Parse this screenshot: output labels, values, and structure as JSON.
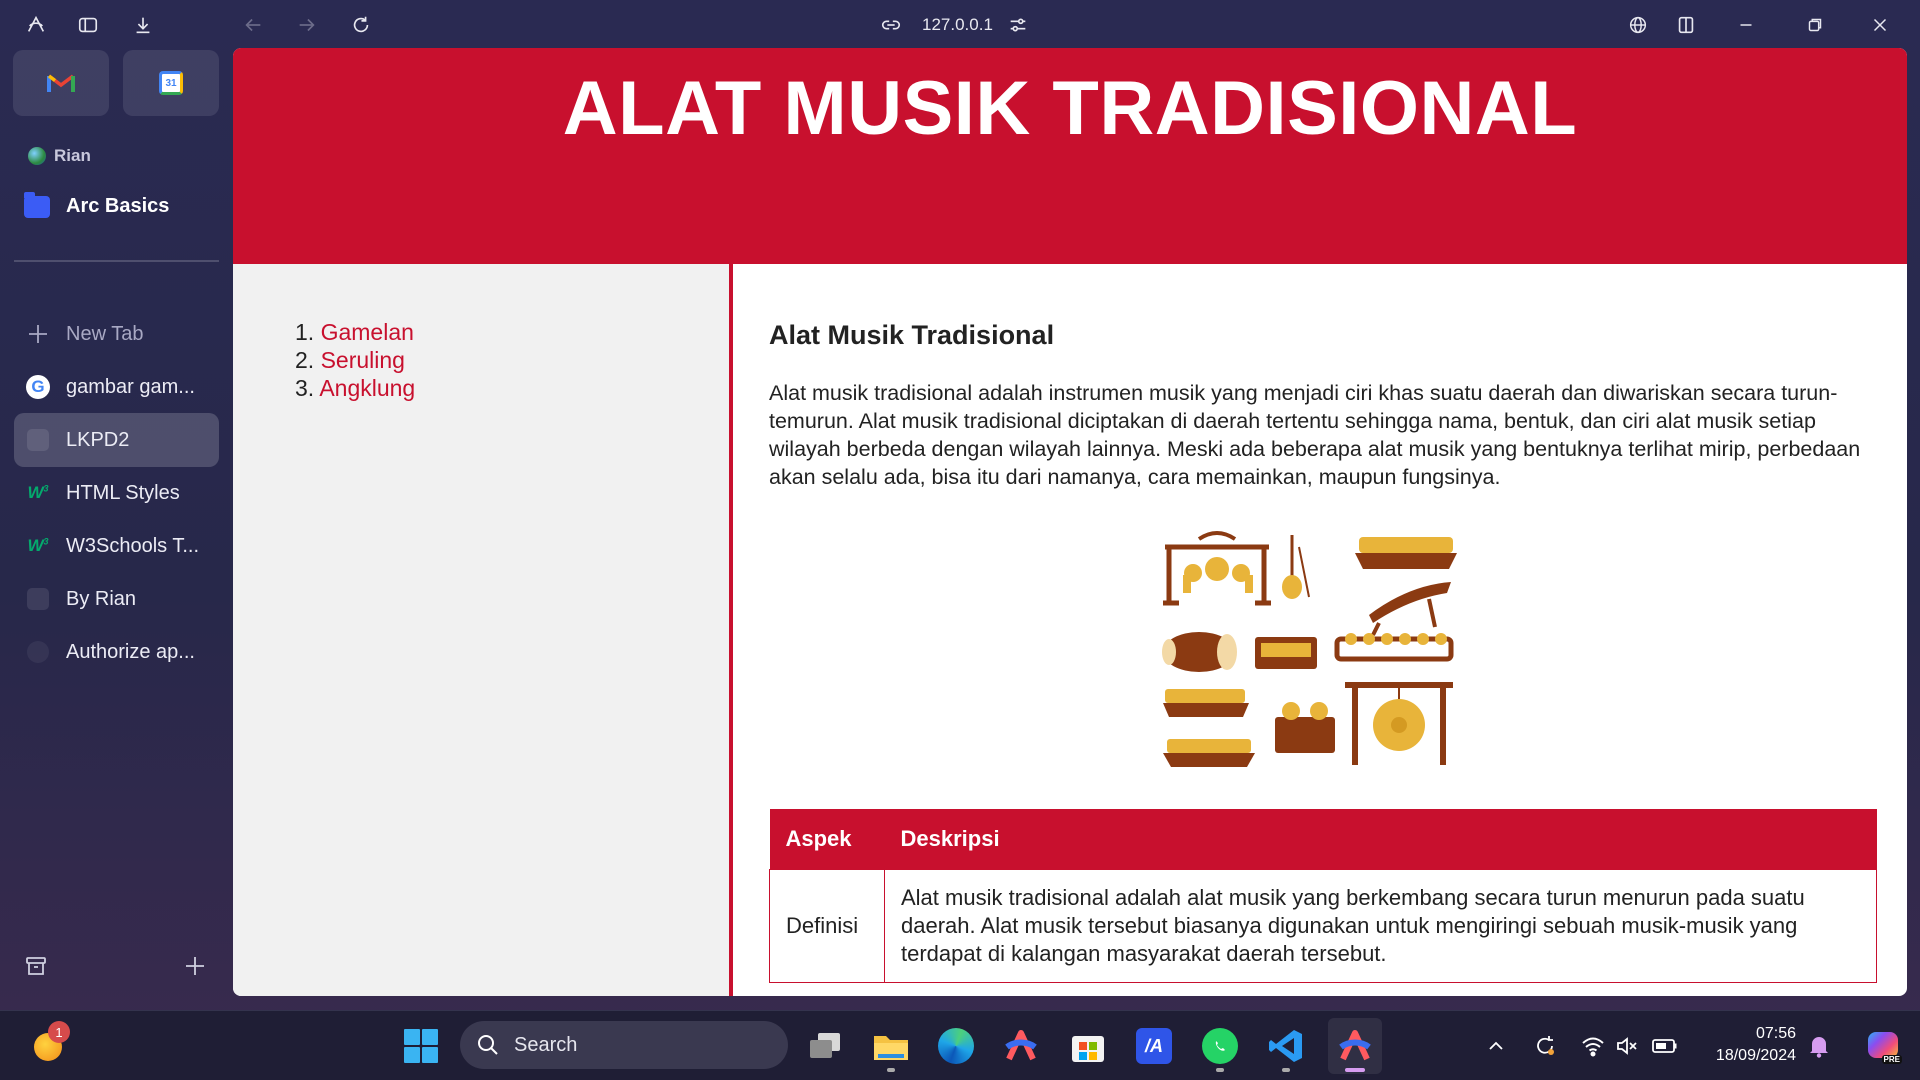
{
  "browser": {
    "url": "127.0.0.1",
    "profile_name": "Rian",
    "space_name": "Arc Basics",
    "new_tab_label": "New Tab",
    "tabs": [
      {
        "label": "gambar gam...",
        "icon": "google-icon"
      },
      {
        "label": "LKPD2",
        "icon": "blank-favicon",
        "active": true
      },
      {
        "label": "HTML Styles",
        "icon": "w3schools-icon"
      },
      {
        "label": "W3Schools T...",
        "icon": "w3schools-icon"
      },
      {
        "label": "By Rian",
        "icon": "blank-favicon"
      },
      {
        "label": "Authorize ap...",
        "icon": "blank-favicon"
      }
    ],
    "pinned": [
      "gmail-icon",
      "google-calendar-icon"
    ],
    "calendar_day": "31"
  },
  "page": {
    "banner_title": "ALAT MUSIK TRADISIONAL",
    "nav": [
      {
        "num": "1.",
        "label": "Gamelan"
      },
      {
        "num": "2.",
        "label": "Seruling"
      },
      {
        "num": "3.",
        "label": "Angklung"
      }
    ],
    "heading": "Alat Musik Tradisional",
    "intro": "Alat musik tradisional adalah instrumen musik yang menjadi ciri khas suatu daerah dan diwariskan secara turun-temurun. Alat musik tradisional diciptakan di daerah tertentu sehingga nama, bentuk, dan ciri alat musik setiap wilayah berbeda dengan wilayah lainnya. Meski ada beberapa alat musik yang bentuknya terlihat mirip, perbedaan akan selalu ada, bisa itu dari namanya, cara memainkan, maupun fungsinya.",
    "table": {
      "headers": [
        "Aspek",
        "Deskripsi"
      ],
      "rows": [
        [
          "Definisi",
          "Alat musik tradisional adalah alat musik yang berkembang secara turun menurun pada suatu daerah. Alat musik tersebut biasanya digunakan untuk mengiringi sebuah musik-musik yang terdapat di kalangan masyarakat daerah tersebut."
        ]
      ]
    },
    "colors": {
      "accent": "#c8102e",
      "nav_bg": "#f1f1f1"
    }
  },
  "taskbar": {
    "search_label": "Search",
    "time": "07:56",
    "date": "18/09/2024",
    "notification_count": "1",
    "copilot_badge": "PRE"
  }
}
